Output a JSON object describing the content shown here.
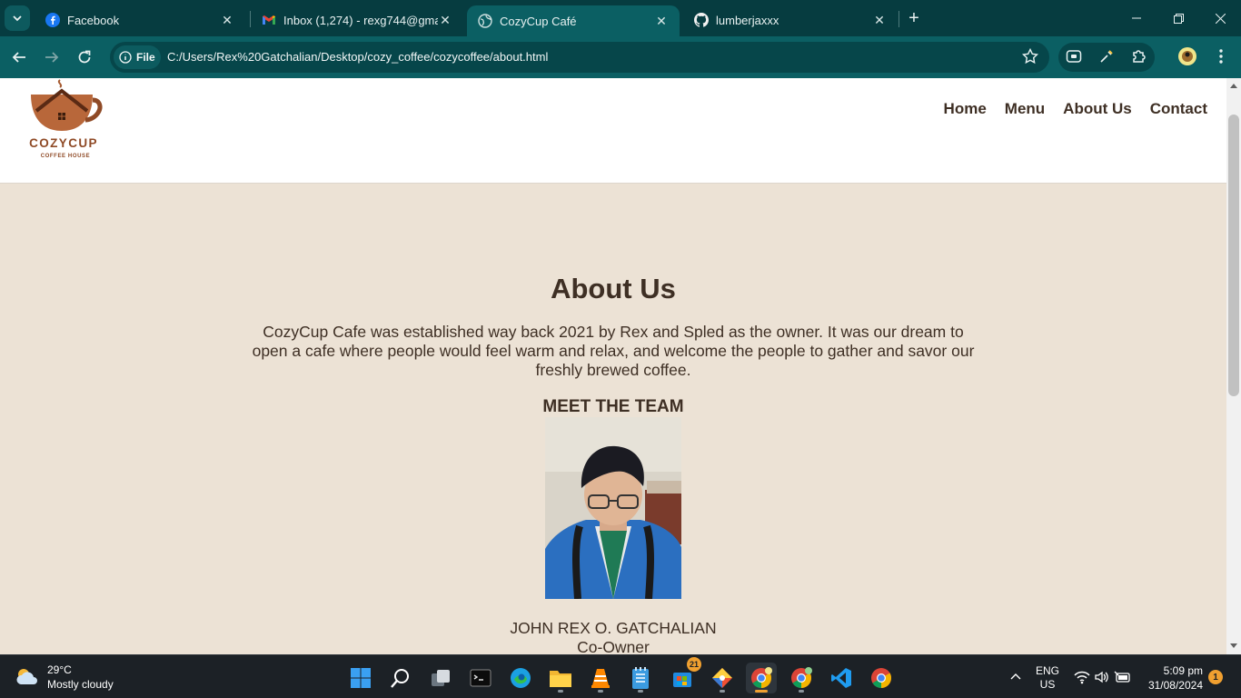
{
  "browser": {
    "tabs": [
      {
        "title": "Facebook",
        "icon": "facebook-icon"
      },
      {
        "title": "Inbox (1,274) - rexg744@gmail.",
        "icon": "gmail-icon"
      },
      {
        "title": "CozyCup Café",
        "icon": "globe-icon"
      },
      {
        "title": "lumberjaxxx",
        "icon": "github-icon"
      }
    ],
    "active_tab": 2,
    "address": {
      "chip_label": "File",
      "url": "C:/Users/Rex%20Gatchalian/Desktop/cozy_coffee/cozycoffee/about.html"
    }
  },
  "site": {
    "logo": {
      "name": "COZYCUP",
      "tagline": "COFFEE HOUSE"
    },
    "nav": [
      "Home",
      "Menu",
      "About Us",
      "Contact"
    ],
    "about": {
      "title": "About Us",
      "text": "CozyCup Cafe was established way back 2021 by Rex and Spled as the owner. It was our dream to open a cafe where people would feel warm and relax, and welcome the people to gather and savor our freshly brewed coffee.",
      "team_heading": "MEET THE TEAM",
      "members": [
        {
          "name": "JOHN REX O. GATCHALIAN",
          "role": "Co-Owner"
        }
      ]
    },
    "colors": {
      "background": "#ece2d5",
      "text": "#3e2f24",
      "accent": "#a65a30"
    }
  },
  "taskbar": {
    "weather": {
      "temp": "29°C",
      "desc": "Mostly cloudy"
    },
    "badge_count": "21",
    "language": {
      "line1": "ENG",
      "line2": "US"
    },
    "time": "5:09 pm",
    "date": "31/08/2024",
    "notifications": "1"
  }
}
